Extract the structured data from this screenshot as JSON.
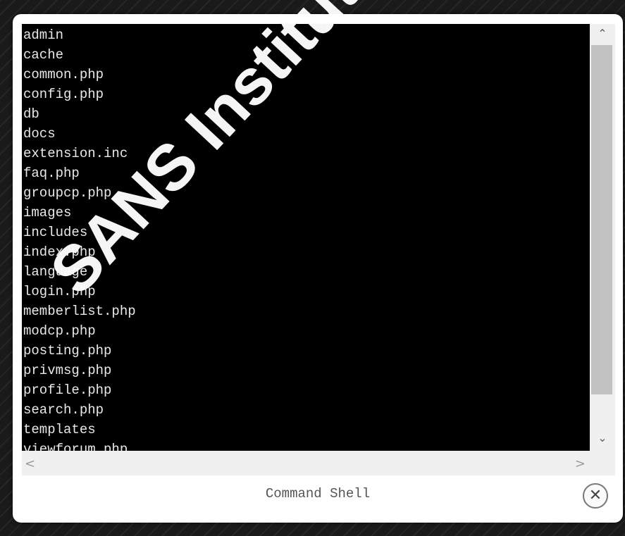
{
  "dialog": {
    "title": "Command Shell",
    "close_label": "✕"
  },
  "terminal": {
    "lines": [
      "admin",
      "cache",
      "common.php",
      "config.php",
      "db",
      "docs",
      "extension.inc",
      "faq.php",
      "groupcp.php",
      "images",
      "includes",
      "index.php",
      "language",
      "login.php",
      "memberlist.php",
      "modcp.php",
      "posting.php",
      "privmsg.php",
      "profile.php",
      "search.php",
      "templates",
      "viewforum.php"
    ]
  },
  "scrollbars": {
    "up_arrow": "⌃",
    "down_arrow": "⌄",
    "left_arrow": "<",
    "right_arrow": ">"
  },
  "watermark": {
    "text": "SANS Institute, Author retains"
  },
  "colors": {
    "terminal_bg": "#000000",
    "terminal_fg": "#e8e8e8",
    "dialog_bg": "#ffffff"
  },
  "icons": {
    "close": "close-icon"
  }
}
